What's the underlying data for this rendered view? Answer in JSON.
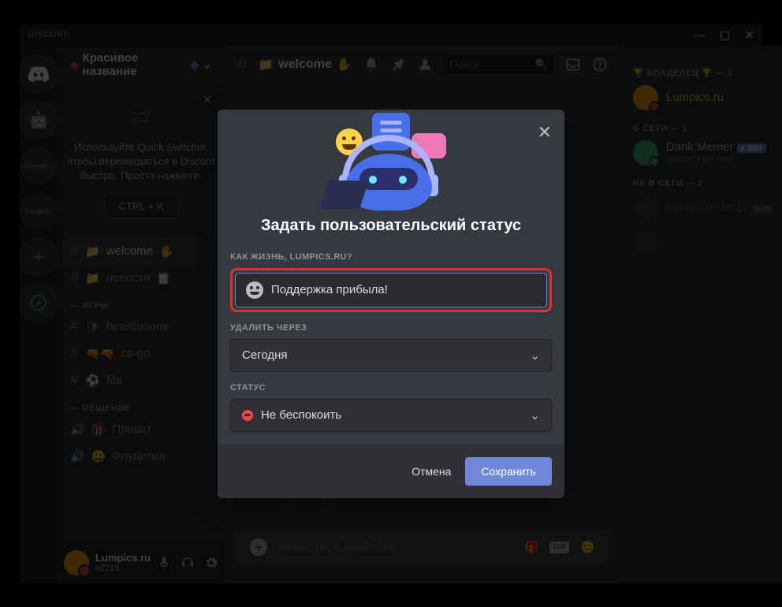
{
  "app": {
    "brand": "DISCORD"
  },
  "server": {
    "name": "Красивое название"
  },
  "quickSwitcher": {
    "text": "Используйте Quick Switcher, чтобы перемещаться в Discord быстро. Просто нажмите:",
    "button": "CTRL + K"
  },
  "channels": {
    "welcome": "welcome",
    "news": "новости",
    "catGames": "— ИГРЫ",
    "hearthstone": "hearthstone",
    "csgo": "cs-go",
    "fifa": "fifa",
    "catChat": "— ОБЩЕНИЕ",
    "privat": "Приват",
    "flood": "Флудилка"
  },
  "userPanel": {
    "name": "Lumpics.ru",
    "tag": "#2719"
  },
  "chat": {
    "title": "welcome",
    "search": "Поиск",
    "inputPlaceholder": "Написать в #welcome",
    "gif": "GIF"
  },
  "members": {
    "ownerCat": "🏆 ВЛАДЕЛЕЦ 🏆 — 1",
    "owner": "Lumpics.ru",
    "onlineCat": "В СЕТИ — 1",
    "dank": "Dank Memer",
    "dankSub": "Играет в pls help",
    "bot": "✔ БОТ",
    "offlineCat": "НЕ В СЕТИ — 2",
    "off1": "botomometer21",
    "botShort": "БОТ"
  },
  "modal": {
    "title": "Задать пользовательский статус",
    "label1": "КАК ЖИЗНЬ, LUMPICS.RU?",
    "statusText": "Поддержка прибыла!",
    "label2": "УДАЛИТЬ ЧЕРЕЗ",
    "clear": "Сегодня",
    "label3": "СТАТУС",
    "dnd": "Не беспокоить",
    "cancel": "Отмена",
    "save": "Сохранить"
  }
}
